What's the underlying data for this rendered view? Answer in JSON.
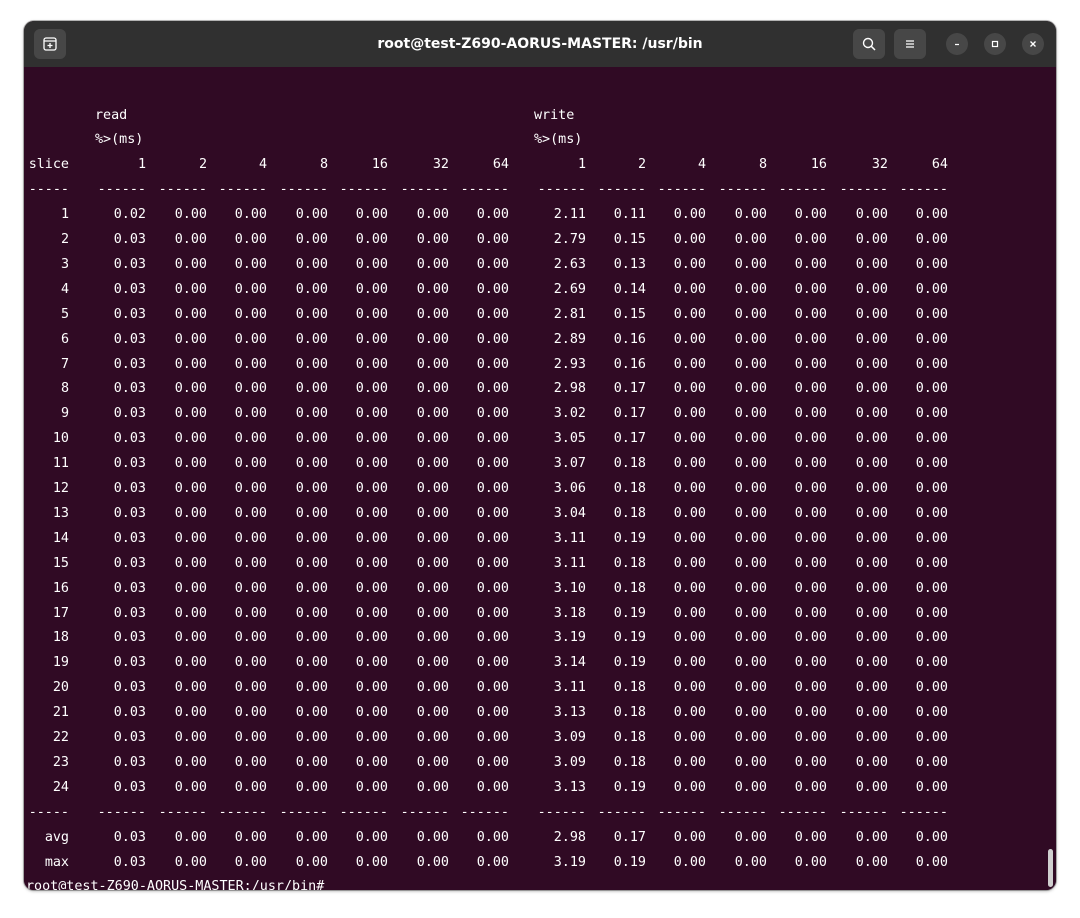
{
  "window": {
    "title": "root@test-Z690-AORUS-MASTER: /usr/bin"
  },
  "header": {
    "read_label": "read",
    "write_label": "write",
    "unit_label": "%>(ms)",
    "slice_label": "slice",
    "columns": [
      "1",
      "2",
      "4",
      "8",
      "16",
      "32",
      "64"
    ],
    "separator_slice": "-----",
    "separator_col": "------"
  },
  "rows": [
    {
      "slice": "1",
      "read": [
        "0.02",
        "0.00",
        "0.00",
        "0.00",
        "0.00",
        "0.00",
        "0.00"
      ],
      "write": [
        "2.11",
        "0.11",
        "0.00",
        "0.00",
        "0.00",
        "0.00",
        "0.00"
      ]
    },
    {
      "slice": "2",
      "read": [
        "0.03",
        "0.00",
        "0.00",
        "0.00",
        "0.00",
        "0.00",
        "0.00"
      ],
      "write": [
        "2.79",
        "0.15",
        "0.00",
        "0.00",
        "0.00",
        "0.00",
        "0.00"
      ]
    },
    {
      "slice": "3",
      "read": [
        "0.03",
        "0.00",
        "0.00",
        "0.00",
        "0.00",
        "0.00",
        "0.00"
      ],
      "write": [
        "2.63",
        "0.13",
        "0.00",
        "0.00",
        "0.00",
        "0.00",
        "0.00"
      ]
    },
    {
      "slice": "4",
      "read": [
        "0.03",
        "0.00",
        "0.00",
        "0.00",
        "0.00",
        "0.00",
        "0.00"
      ],
      "write": [
        "2.69",
        "0.14",
        "0.00",
        "0.00",
        "0.00",
        "0.00",
        "0.00"
      ]
    },
    {
      "slice": "5",
      "read": [
        "0.03",
        "0.00",
        "0.00",
        "0.00",
        "0.00",
        "0.00",
        "0.00"
      ],
      "write": [
        "2.81",
        "0.15",
        "0.00",
        "0.00",
        "0.00",
        "0.00",
        "0.00"
      ]
    },
    {
      "slice": "6",
      "read": [
        "0.03",
        "0.00",
        "0.00",
        "0.00",
        "0.00",
        "0.00",
        "0.00"
      ],
      "write": [
        "2.89",
        "0.16",
        "0.00",
        "0.00",
        "0.00",
        "0.00",
        "0.00"
      ]
    },
    {
      "slice": "7",
      "read": [
        "0.03",
        "0.00",
        "0.00",
        "0.00",
        "0.00",
        "0.00",
        "0.00"
      ],
      "write": [
        "2.93",
        "0.16",
        "0.00",
        "0.00",
        "0.00",
        "0.00",
        "0.00"
      ]
    },
    {
      "slice": "8",
      "read": [
        "0.03",
        "0.00",
        "0.00",
        "0.00",
        "0.00",
        "0.00",
        "0.00"
      ],
      "write": [
        "2.98",
        "0.17",
        "0.00",
        "0.00",
        "0.00",
        "0.00",
        "0.00"
      ]
    },
    {
      "slice": "9",
      "read": [
        "0.03",
        "0.00",
        "0.00",
        "0.00",
        "0.00",
        "0.00",
        "0.00"
      ],
      "write": [
        "3.02",
        "0.17",
        "0.00",
        "0.00",
        "0.00",
        "0.00",
        "0.00"
      ]
    },
    {
      "slice": "10",
      "read": [
        "0.03",
        "0.00",
        "0.00",
        "0.00",
        "0.00",
        "0.00",
        "0.00"
      ],
      "write": [
        "3.05",
        "0.17",
        "0.00",
        "0.00",
        "0.00",
        "0.00",
        "0.00"
      ]
    },
    {
      "slice": "11",
      "read": [
        "0.03",
        "0.00",
        "0.00",
        "0.00",
        "0.00",
        "0.00",
        "0.00"
      ],
      "write": [
        "3.07",
        "0.18",
        "0.00",
        "0.00",
        "0.00",
        "0.00",
        "0.00"
      ]
    },
    {
      "slice": "12",
      "read": [
        "0.03",
        "0.00",
        "0.00",
        "0.00",
        "0.00",
        "0.00",
        "0.00"
      ],
      "write": [
        "3.06",
        "0.18",
        "0.00",
        "0.00",
        "0.00",
        "0.00",
        "0.00"
      ]
    },
    {
      "slice": "13",
      "read": [
        "0.03",
        "0.00",
        "0.00",
        "0.00",
        "0.00",
        "0.00",
        "0.00"
      ],
      "write": [
        "3.04",
        "0.18",
        "0.00",
        "0.00",
        "0.00",
        "0.00",
        "0.00"
      ]
    },
    {
      "slice": "14",
      "read": [
        "0.03",
        "0.00",
        "0.00",
        "0.00",
        "0.00",
        "0.00",
        "0.00"
      ],
      "write": [
        "3.11",
        "0.19",
        "0.00",
        "0.00",
        "0.00",
        "0.00",
        "0.00"
      ]
    },
    {
      "slice": "15",
      "read": [
        "0.03",
        "0.00",
        "0.00",
        "0.00",
        "0.00",
        "0.00",
        "0.00"
      ],
      "write": [
        "3.11",
        "0.18",
        "0.00",
        "0.00",
        "0.00",
        "0.00",
        "0.00"
      ]
    },
    {
      "slice": "16",
      "read": [
        "0.03",
        "0.00",
        "0.00",
        "0.00",
        "0.00",
        "0.00",
        "0.00"
      ],
      "write": [
        "3.10",
        "0.18",
        "0.00",
        "0.00",
        "0.00",
        "0.00",
        "0.00"
      ]
    },
    {
      "slice": "17",
      "read": [
        "0.03",
        "0.00",
        "0.00",
        "0.00",
        "0.00",
        "0.00",
        "0.00"
      ],
      "write": [
        "3.18",
        "0.19",
        "0.00",
        "0.00",
        "0.00",
        "0.00",
        "0.00"
      ]
    },
    {
      "slice": "18",
      "read": [
        "0.03",
        "0.00",
        "0.00",
        "0.00",
        "0.00",
        "0.00",
        "0.00"
      ],
      "write": [
        "3.19",
        "0.19",
        "0.00",
        "0.00",
        "0.00",
        "0.00",
        "0.00"
      ]
    },
    {
      "slice": "19",
      "read": [
        "0.03",
        "0.00",
        "0.00",
        "0.00",
        "0.00",
        "0.00",
        "0.00"
      ],
      "write": [
        "3.14",
        "0.19",
        "0.00",
        "0.00",
        "0.00",
        "0.00",
        "0.00"
      ]
    },
    {
      "slice": "20",
      "read": [
        "0.03",
        "0.00",
        "0.00",
        "0.00",
        "0.00",
        "0.00",
        "0.00"
      ],
      "write": [
        "3.11",
        "0.18",
        "0.00",
        "0.00",
        "0.00",
        "0.00",
        "0.00"
      ]
    },
    {
      "slice": "21",
      "read": [
        "0.03",
        "0.00",
        "0.00",
        "0.00",
        "0.00",
        "0.00",
        "0.00"
      ],
      "write": [
        "3.13",
        "0.18",
        "0.00",
        "0.00",
        "0.00",
        "0.00",
        "0.00"
      ]
    },
    {
      "slice": "22",
      "read": [
        "0.03",
        "0.00",
        "0.00",
        "0.00",
        "0.00",
        "0.00",
        "0.00"
      ],
      "write": [
        "3.09",
        "0.18",
        "0.00",
        "0.00",
        "0.00",
        "0.00",
        "0.00"
      ]
    },
    {
      "slice": "23",
      "read": [
        "0.03",
        "0.00",
        "0.00",
        "0.00",
        "0.00",
        "0.00",
        "0.00"
      ],
      "write": [
        "3.09",
        "0.18",
        "0.00",
        "0.00",
        "0.00",
        "0.00",
        "0.00"
      ]
    },
    {
      "slice": "24",
      "read": [
        "0.03",
        "0.00",
        "0.00",
        "0.00",
        "0.00",
        "0.00",
        "0.00"
      ],
      "write": [
        "3.13",
        "0.19",
        "0.00",
        "0.00",
        "0.00",
        "0.00",
        "0.00"
      ]
    }
  ],
  "summary": [
    {
      "slice": "avg",
      "read": [
        "0.03",
        "0.00",
        "0.00",
        "0.00",
        "0.00",
        "0.00",
        "0.00"
      ],
      "write": [
        "2.98",
        "0.17",
        "0.00",
        "0.00",
        "0.00",
        "0.00",
        "0.00"
      ]
    },
    {
      "slice": "max",
      "read": [
        "0.03",
        "0.00",
        "0.00",
        "0.00",
        "0.00",
        "0.00",
        "0.00"
      ],
      "write": [
        "3.19",
        "0.19",
        "0.00",
        "0.00",
        "0.00",
        "0.00",
        "0.00"
      ]
    }
  ],
  "prompt": "root@test-Z690-AORUS-MASTER:/usr/bin#",
  "icons": {
    "new_tab": "new-tab-icon",
    "search": "search-icon",
    "menu": "hamburger-menu-icon",
    "minimize": "minimize-icon",
    "maximize": "maximize-icon",
    "close": "close-icon"
  },
  "colors": {
    "terminal_bg": "#300a24",
    "titlebar_bg": "#303030",
    "text": "#ffffff"
  }
}
